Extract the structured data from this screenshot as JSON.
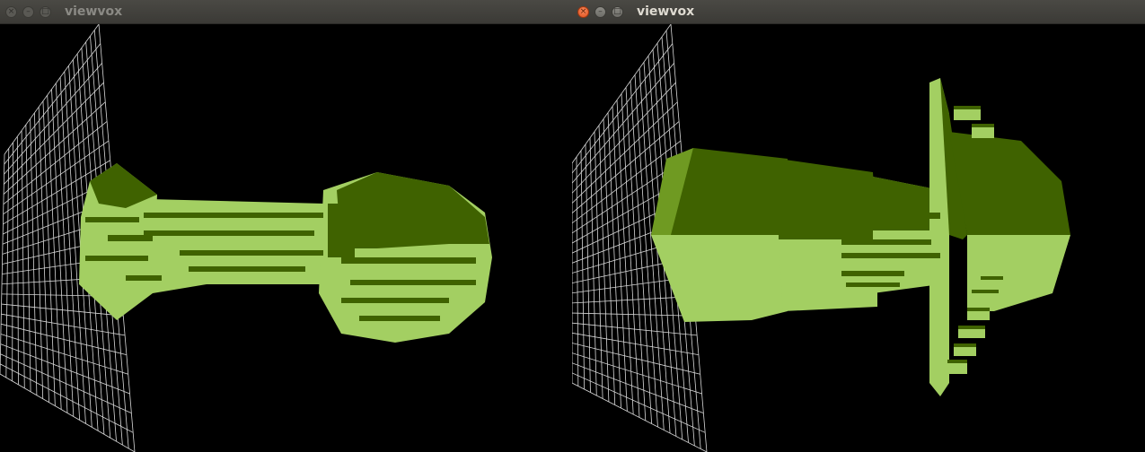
{
  "windows": [
    {
      "title": "viewvox",
      "focused": false,
      "controls": {
        "close_glyph": "×",
        "minimize_glyph": "–",
        "maximize_glyph": "□"
      },
      "content": "voxel-model-render"
    },
    {
      "title": "viewvox",
      "focused": true,
      "controls": {
        "close_glyph": "×",
        "minimize_glyph": "–",
        "maximize_glyph": "□"
      },
      "content": "voxel-model-render"
    }
  ],
  "colors": {
    "background": "#000000",
    "grid": "#d8d8d8",
    "voxel_light": "#a3cf62",
    "voxel_dark": "#3f6200",
    "voxel_mid": "#6f9a22"
  }
}
